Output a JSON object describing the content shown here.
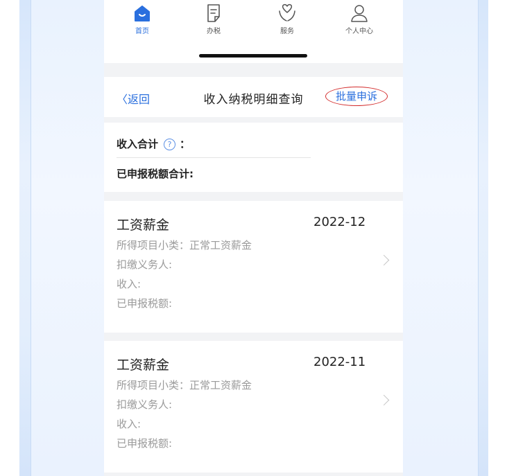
{
  "tabbar": {
    "items": [
      {
        "label": "首页",
        "icon": "home-icon",
        "active": true
      },
      {
        "label": "办税",
        "icon": "document-edit-icon",
        "active": false
      },
      {
        "label": "服务",
        "icon": "heart-hands-icon",
        "active": false
      },
      {
        "label": "个人中心",
        "icon": "person-icon",
        "active": false
      }
    ]
  },
  "nav": {
    "back_label": "〈返回",
    "title": "收入纳税明细查询",
    "action_label": "批量申诉"
  },
  "summary": {
    "income_total_label": "收入合计",
    "help_glyph": "?",
    "colon": "：",
    "tax_total_label": "已申报税额合计:"
  },
  "records": [
    {
      "title": "工资薪金",
      "date": "2022-12",
      "subcategory": "所得项目小类：正常工资薪金",
      "withholder": "扣缴义务人:",
      "income": "收入:",
      "tax": "已申报税额:"
    },
    {
      "title": "工资薪金",
      "date": "2022-11",
      "subcategory": "所得项目小类：正常工资薪金",
      "withholder": "扣缴义务人:",
      "income": "收入:",
      "tax": "已申报税额:"
    }
  ],
  "colors": {
    "accent": "#2a6fde",
    "highlight_circle": "#d32b2b"
  }
}
